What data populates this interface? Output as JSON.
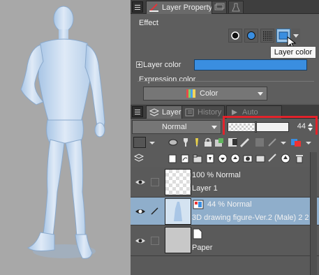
{
  "layer_property_panel": {
    "tab_label": "Layer Property",
    "effect_label": "Effect",
    "layer_color_label": "Layer color",
    "layer_color_swatch": "#3a8ee0",
    "tooltip": "Layer color",
    "expression_color_label": "Expression color",
    "expression_color_value": "Color"
  },
  "layer_panel": {
    "tab_label": "Layer",
    "history_tab_label": "History",
    "auto_action_tab_label": "Auto Action",
    "blend_mode": "Normal",
    "opacity": "44",
    "layers": [
      {
        "line1": "100 % Normal",
        "line2": "Layer 1",
        "selected": false
      },
      {
        "line1": "44 % Normal",
        "line2": "3D drawing figure-Ver.2 (Male) 2 2",
        "selected": true
      },
      {
        "line1": "",
        "line2": "Paper",
        "selected": false
      }
    ]
  },
  "colors": {
    "highlight_box": "#e2232b",
    "selected_row": "#8faecb",
    "accent_blue": "#3a8ee0"
  }
}
